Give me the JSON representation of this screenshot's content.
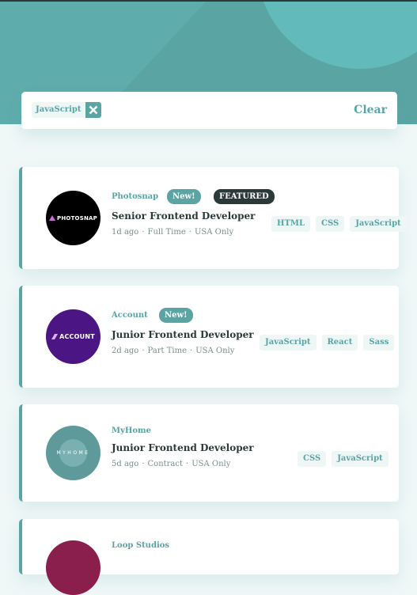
{
  "filter": {
    "active": [
      {
        "label": "JavaScript"
      }
    ],
    "clear_label": "Clear"
  },
  "jobs": [
    {
      "company": "Photosnap",
      "logo_text": "PHOTOSNAP",
      "logo_color": "#000000",
      "is_new": true,
      "new_label": "New!",
      "is_featured": true,
      "featured_label": "FEATURED",
      "position": "Senior Frontend Developer",
      "posted": "1d ago",
      "contract": "Full Time",
      "location": "USA Only",
      "tags": [
        "HTML",
        "CSS",
        "JavaScript"
      ]
    },
    {
      "company": "Account",
      "logo_text": "ACCOUNT",
      "logo_color": "#4b1584",
      "is_new": true,
      "new_label": "New!",
      "is_featured": false,
      "position": "Junior Frontend Developer",
      "posted": "2d ago",
      "contract": "Part Time",
      "location": "USA Only",
      "tags": [
        "JavaScript",
        "React",
        "Sass"
      ]
    },
    {
      "company": "MyHome",
      "logo_text": "MYHOME",
      "logo_color": "#5f9a9a",
      "is_new": false,
      "is_featured": false,
      "position": "Junior Frontend Developer",
      "posted": "5d ago",
      "contract": "Contract",
      "location": "USA Only",
      "tags": [
        "CSS",
        "JavaScript"
      ]
    },
    {
      "company": "Loop Studios",
      "logo_color": "#8a1e4d"
    }
  ],
  "colors": {
    "primary": "#5ba4a4",
    "dark": "#2b3939",
    "background": "#eff7f7",
    "tag_bg": "#eef6f6"
  }
}
